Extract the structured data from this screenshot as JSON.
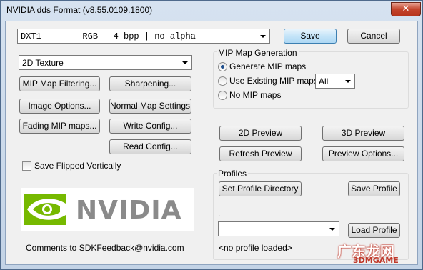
{
  "window": {
    "title": "NVIDIA dds Format (v8.55.0109.1800)",
    "close_glyph": "✕"
  },
  "format_combo": {
    "value": "DXT1        RGB   4 bpp | no alpha"
  },
  "buttons": {
    "save": "Save",
    "cancel": "Cancel",
    "mip_filtering": "MIP Map Filtering...",
    "sharpening": "Sharpening...",
    "image_options": "Image Options...",
    "normal_map": "Normal Map Settings...",
    "fading_mip": "Fading MIP maps...",
    "write_config": "Write Config...",
    "read_config": "Read Config...",
    "preview_2d": "2D Preview",
    "preview_3d": "3D Preview",
    "refresh_preview": "Refresh Preview",
    "preview_options": "Preview Options...",
    "set_profile_dir": "Set Profile Directory",
    "save_profile": "Save Profile",
    "load_profile": "Load Profile"
  },
  "texture_combo": {
    "value": "2D Texture"
  },
  "save_flipped": {
    "label": "Save Flipped Vertically",
    "checked": false
  },
  "mip_group": {
    "label": "MIP Map Generation",
    "options": [
      {
        "label": "Generate MIP maps",
        "selected": true
      },
      {
        "label": "Use Existing MIP maps",
        "selected": false
      },
      {
        "label": "No MIP maps",
        "selected": false
      }
    ],
    "count_combo": "All"
  },
  "profiles": {
    "label": "Profiles",
    "dot": ".",
    "combo_value": "",
    "status": "<no profile loaded>"
  },
  "logo_text": "NVIDIA",
  "feedback": "Comments to SDKFeedback@nvidia.com",
  "watermark": {
    "text1": "广东龙网",
    "text2": "3DMGAME"
  },
  "colors": {
    "nvidia_green": "#76b900",
    "title_bg": "#c3d3e6"
  }
}
